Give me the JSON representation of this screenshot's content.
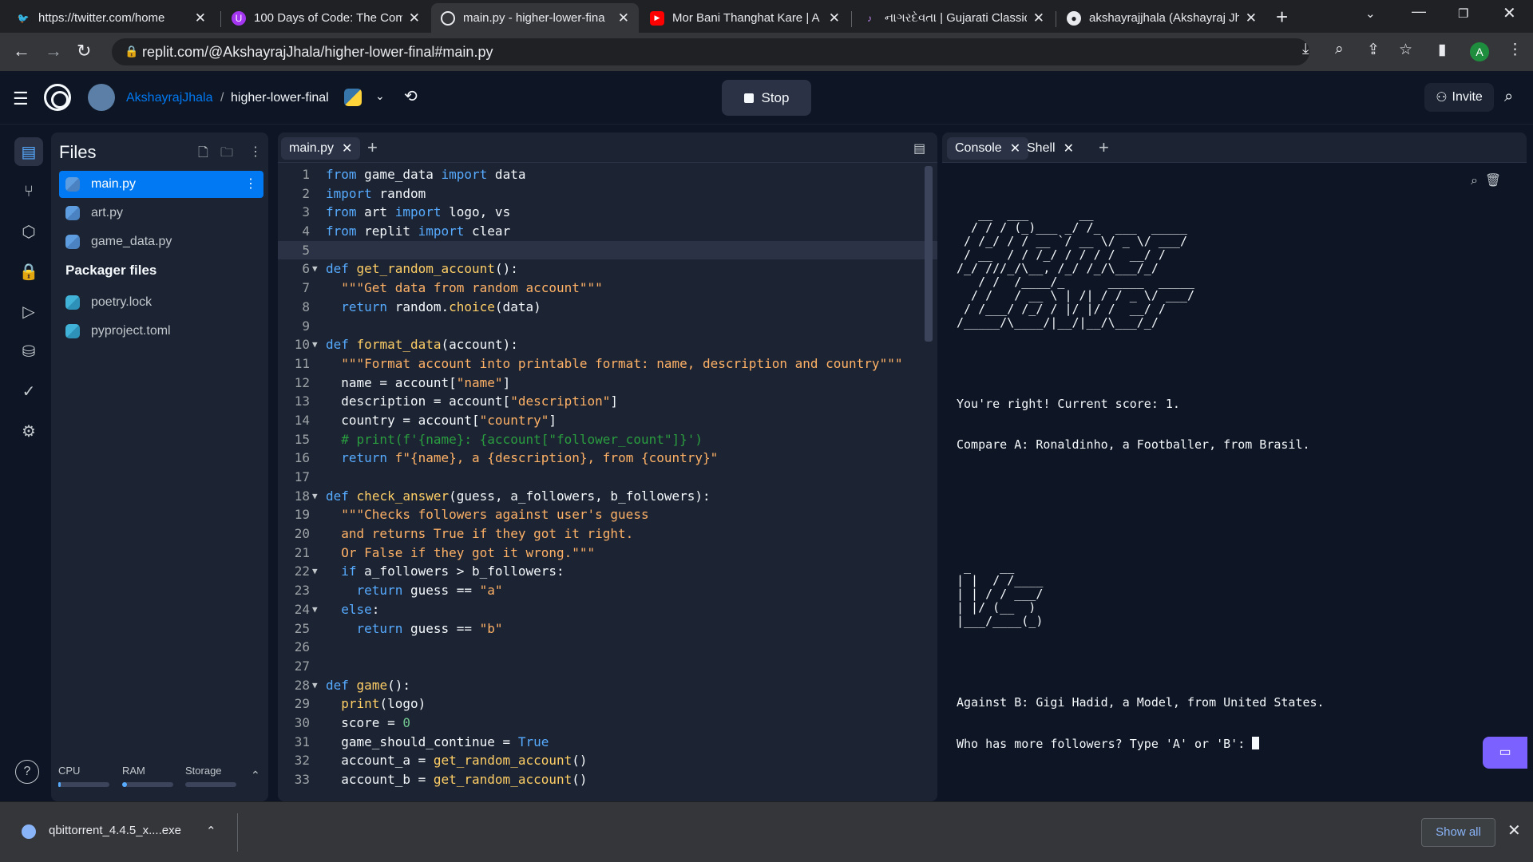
{
  "browser": {
    "tabs": [
      {
        "title": "https://twitter.com/home",
        "favicon": "twitter-icon"
      },
      {
        "title": "100 Days of Code: The Com",
        "favicon": "udemy-icon"
      },
      {
        "title": "main.py - higher-lower-fina",
        "favicon": "replit-icon",
        "active": true
      },
      {
        "title": "Mor Bani Thanghat Kare | A",
        "favicon": "youtube-icon"
      },
      {
        "title": "નાગરદેવતા | Gujarati Classics",
        "favicon": "music-icon"
      },
      {
        "title": "akshayrajjhala (Akshayraj Jh",
        "favicon": "github-icon"
      }
    ],
    "url": "replit.com/@AkshayrajJhala/higher-lower-final#main.py",
    "profile_initial": "A"
  },
  "replit": {
    "username": "AkshayrajJhala",
    "separator": "/",
    "repl_name": "higher-lower-final",
    "stop_label": "Stop",
    "invite_label": "Invite"
  },
  "files": {
    "title": "Files",
    "items": [
      {
        "name": "main.py"
      },
      {
        "name": "art.py"
      },
      {
        "name": "game_data.py"
      }
    ],
    "packager_title": "Packager files",
    "packager_items": [
      {
        "name": "poetry.lock"
      },
      {
        "name": "pyproject.toml"
      }
    ],
    "resources": {
      "cpu_label": "CPU",
      "cpu_level": 0.05,
      "ram_label": "RAM",
      "ram_level": 0.1,
      "storage_label": "Storage",
      "storage_level": 0.0
    }
  },
  "editor": {
    "tab_label": "main.py",
    "current_line": 5,
    "lines": [
      "from game_data import data",
      "import random",
      "from art import logo, vs",
      "from replit import clear",
      "",
      "def get_random_account():",
      "  \"\"\"Get data from random account\"\"\"",
      "  return random.choice(data)",
      "",
      "def format_data(account):",
      "  \"\"\"Format account into printable format: name, description and country\"\"\"",
      "  name = account[\"name\"]",
      "  description = account[\"description\"]",
      "  country = account[\"country\"]",
      "  # print(f'{name}: {account[\"follower_count\"]}')",
      "  return f\"{name}, a {description}, from {country}\"",
      "",
      "def check_answer(guess, a_followers, b_followers):",
      "  \"\"\"Checks followers against user's guess",
      "  and returns True if they got it right.",
      "  Or False if they got it wrong.\"\"\"",
      "  if a_followers > b_followers:",
      "    return guess == \"a\"",
      "  else:",
      "    return guess == \"b\"",
      "",
      "",
      "def game():",
      "  print(logo)",
      "  score = 0",
      "  game_should_continue = True",
      "  account_a = get_random_account()",
      "  account_b = get_random_account()"
    ]
  },
  "console": {
    "tab_console": "Console",
    "tab_shell": "Shell",
    "logo_lines": [
      "   __  ___       __",
      "  / / / (_)___ _/ /_  ___  _____",
      " / /_/ / / __ `/ __ \\/ _ \\/ ___/",
      " / __  / / /_/ / / / /  __/ /",
      "/_/ ///_/\\__, /_/ /_/\\___/_/",
      "   / /  /____/_      _____  _____",
      "  / /   / __ \\ | /| / / _ \\/ ___/",
      " / /___/ /_/ / |/ |/ /  __/ /",
      "/_____/\\____/|__/|__/\\___/_/"
    ],
    "score_line": "You're right! Current score: 1.",
    "compare_a": "Compare A: Ronaldinho, a Footballer, from Brasil.",
    "vs_lines": [
      " _    __",
      "| |  / /____",
      "| | / / ___/",
      "| |/ (__  )",
      "|___/____(_)"
    ],
    "against_b": "Against B: Gigi Hadid, a Model, from United States.",
    "prompt": "Who has more followers? Type 'A' or 'B': "
  },
  "downloads": {
    "filename": "qbittorrent_4.4.5_x....exe",
    "show_all": "Show all"
  }
}
